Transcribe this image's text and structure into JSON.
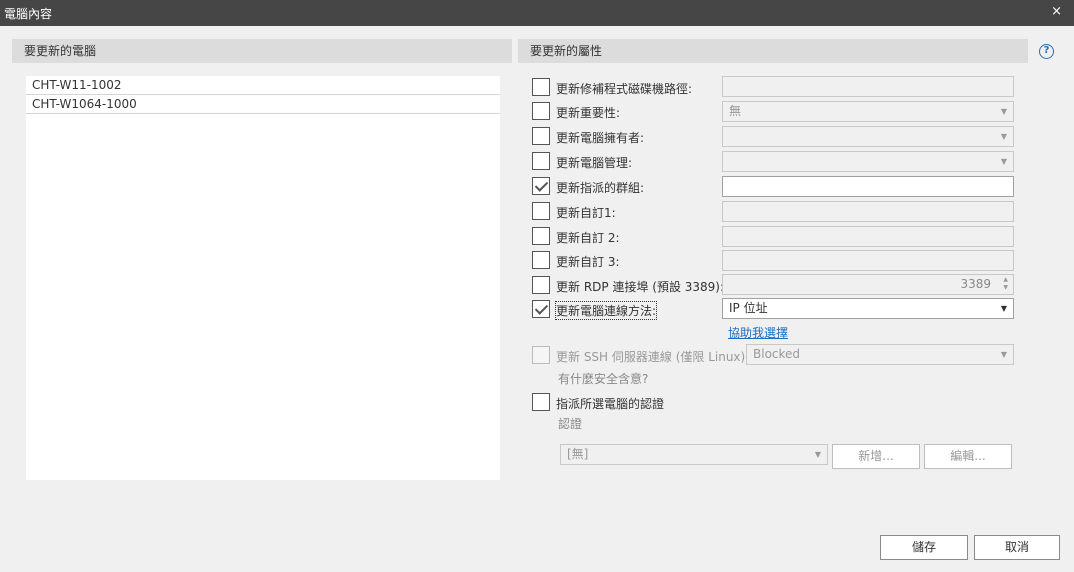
{
  "window": {
    "title": "電腦內容",
    "close_glyph": "×"
  },
  "left_panel": {
    "header": "要更新的電腦",
    "computers": [
      "CHT-W11-1002",
      "CHT-W1064-1000"
    ]
  },
  "right_panel": {
    "header": "要更新的屬性",
    "help_glyph": "?",
    "properties": {
      "driver_path": {
        "label": "更新修補程式磁碟機路徑:",
        "checked": false,
        "value": ""
      },
      "importance": {
        "label": "更新重要性:",
        "checked": false,
        "value": "無"
      },
      "owner": {
        "label": "更新電腦擁有者:",
        "checked": false,
        "value": ""
      },
      "management": {
        "label": "更新電腦管理:",
        "checked": false,
        "value": ""
      },
      "group": {
        "label": "更新指派的群組:",
        "checked": true,
        "value": ""
      },
      "custom1": {
        "label": "更新自訂1:",
        "checked": false,
        "value": ""
      },
      "custom2": {
        "label": "更新自訂 2:",
        "checked": false,
        "value": ""
      },
      "custom3": {
        "label": "更新自訂 3:",
        "checked": false,
        "value": ""
      },
      "rdp_port": {
        "label": "更新 RDP 連接埠 (預設 3389):",
        "checked": false,
        "value": "3389"
      },
      "connection_method": {
        "label": "更新電腦連線方法:",
        "checked": true,
        "value": "IP 位址"
      },
      "ssh": {
        "label": "更新 SSH 伺服器連線 (僅限 Linux):",
        "checked": false,
        "value": "Blocked"
      },
      "credentials": {
        "label": "指派所選電腦的認證",
        "checked": false,
        "value": "[無]"
      }
    },
    "help_choose_link": "協助我選擇",
    "security_note": "有什麼安全含意?",
    "credentials_sublabel": "認證",
    "add_button": "新增...",
    "edit_button": "編輯..."
  },
  "footer": {
    "save_button": "儲存",
    "cancel_button": "取消"
  },
  "colors": {
    "titlebar": "#464646",
    "link": "#1a6fc4",
    "background": "#f0f0f0"
  }
}
